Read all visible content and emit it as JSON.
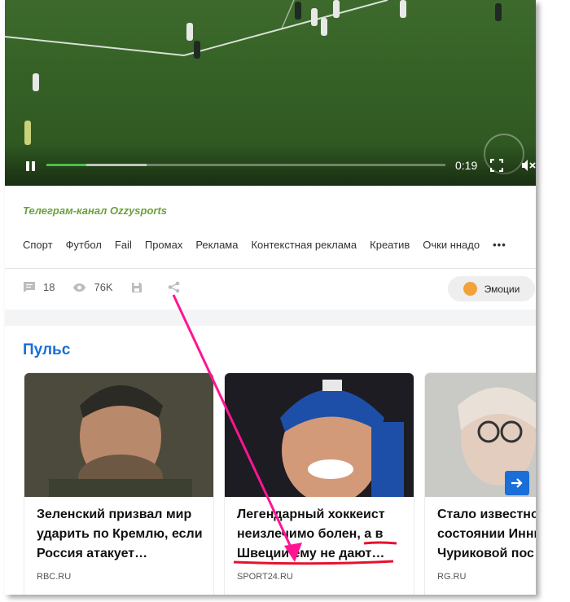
{
  "video": {
    "time": "0:19",
    "progress": 0.1,
    "buffered": 0.25
  },
  "channel": "Телеграм-канал Ozzysports",
  "tags": [
    "Спорт",
    "Футбол",
    "Fail",
    "Промах",
    "Реклама",
    "Контекстная реклама",
    "Креатив",
    "Очки ннадо",
    "•••"
  ],
  "stats": {
    "comments": "18",
    "views": "76K"
  },
  "emotions_label": "Эмоции",
  "pulse": {
    "heading": "Пульс",
    "cards": [
      {
        "title": "Зеленский призвал мир ударить по Кремлю, если Россия атакует…",
        "source": "RBC.RU"
      },
      {
        "title": "Легендарный хоккеист неизлечимо болен, а в Швеции ему не дают…",
        "source": "SPORT24.RU"
      },
      {
        "title": "Стало известно о состоянии Инны Чуриковой пос",
        "source": "RG.RU"
      }
    ]
  },
  "colors": {
    "accent": "#1a6ed8",
    "channel": "#6aa03a",
    "annotation": "#ff1493",
    "underline": "#e8112d"
  },
  "icons": [
    "play-pause-icon",
    "fullscreen-icon",
    "mute-icon",
    "comment-icon",
    "eye-icon",
    "save-icon",
    "share-icon",
    "emoji-icon",
    "arrow-right-icon"
  ]
}
